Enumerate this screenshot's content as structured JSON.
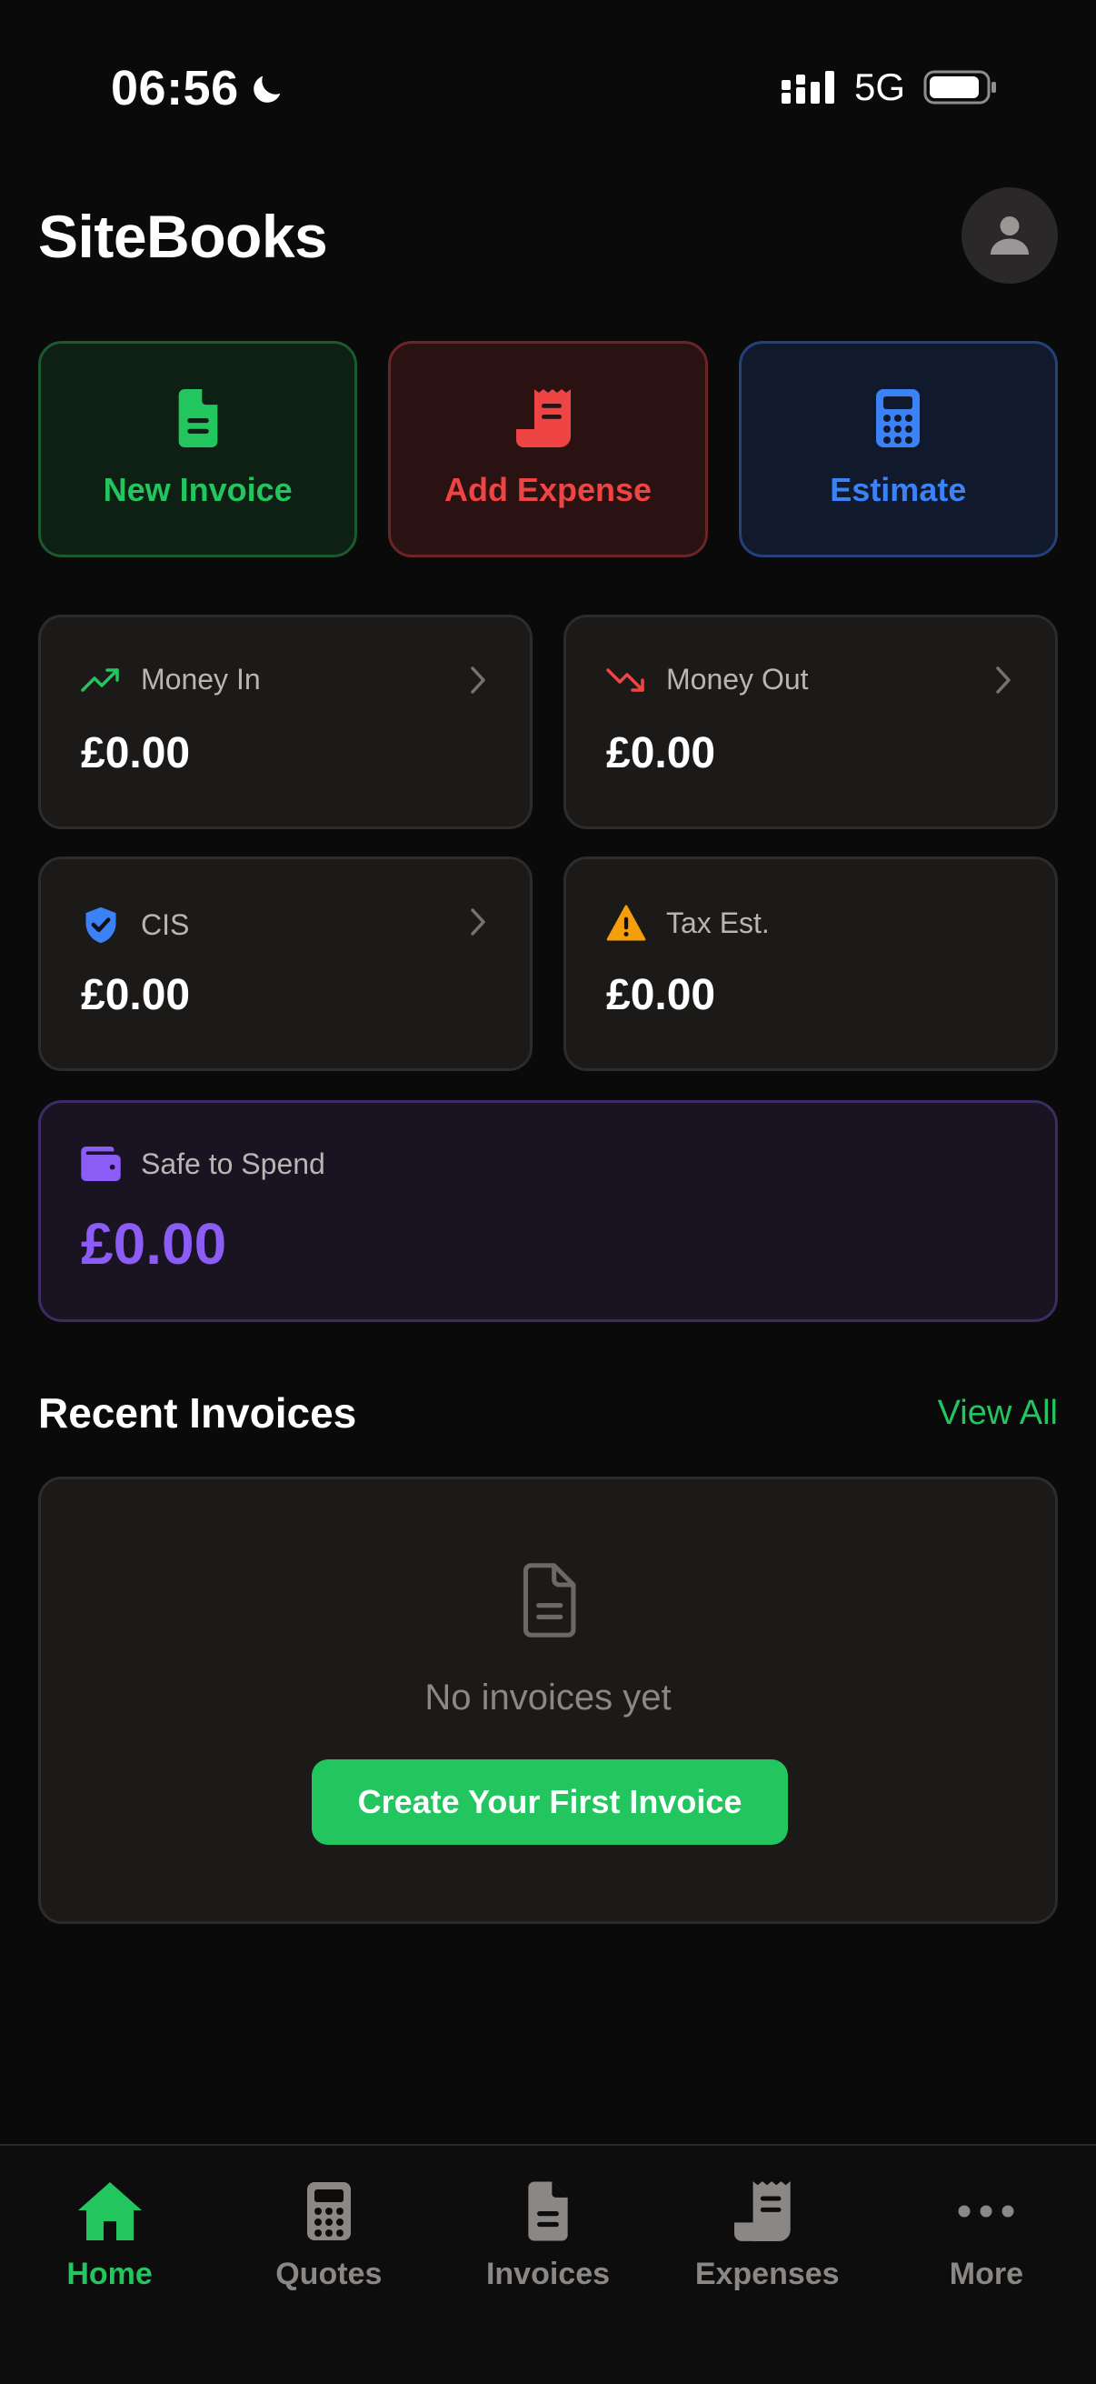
{
  "status_bar": {
    "time": "06:56",
    "network": "5G"
  },
  "header": {
    "title": "SiteBooks"
  },
  "actions": [
    {
      "label": "New Invoice",
      "icon": "invoice-file-icon",
      "color": "#22c55e"
    },
    {
      "label": "Add Expense",
      "icon": "receipt-icon",
      "color": "#ef4444"
    },
    {
      "label": "Estimate",
      "icon": "calculator-icon",
      "color": "#3b82f6"
    }
  ],
  "stats": {
    "money_in": {
      "label": "Money In",
      "value": "£0.00",
      "icon": "trending-up-icon"
    },
    "money_out": {
      "label": "Money Out",
      "value": "£0.00",
      "icon": "trending-down-icon"
    },
    "cis": {
      "label": "CIS",
      "value": "£0.00",
      "icon": "shield-check-icon"
    },
    "tax_est": {
      "label": "Tax Est.",
      "value": "£0.00",
      "icon": "warning-icon"
    },
    "safe_to_spend": {
      "label": "Safe to Spend",
      "value": "£0.00",
      "icon": "wallet-icon"
    }
  },
  "recent_invoices": {
    "title": "Recent Invoices",
    "view_all": "View All",
    "empty_text": "No invoices yet",
    "cta": "Create Your First Invoice"
  },
  "tabs": [
    {
      "label": "Home",
      "icon": "home-icon",
      "active": true
    },
    {
      "label": "Quotes",
      "icon": "calculator-icon"
    },
    {
      "label": "Invoices",
      "icon": "document-icon"
    },
    {
      "label": "Expenses",
      "icon": "receipt-icon"
    },
    {
      "label": "More",
      "icon": "more-dots-icon"
    }
  ],
  "colors": {
    "accent": "#22c55e",
    "danger": "#ef4444",
    "info": "#3b82f6",
    "purple": "#8b5cf6",
    "warning": "#f59e0b"
  }
}
